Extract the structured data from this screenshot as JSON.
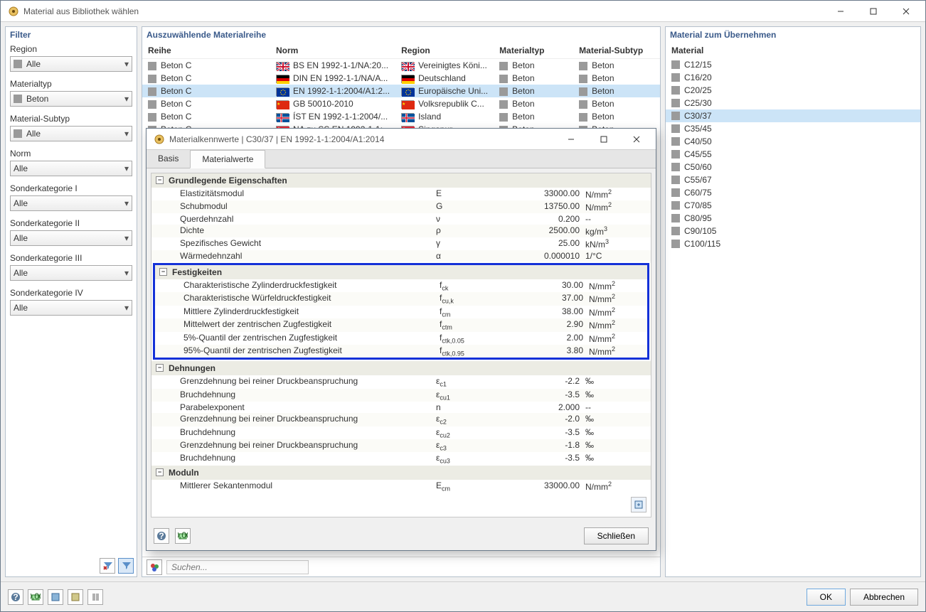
{
  "window": {
    "title": "Material aus Bibliothek wählen"
  },
  "filter": {
    "title": "Filter",
    "groups": [
      {
        "label": "Region",
        "value": "Alle",
        "swatch": true
      },
      {
        "label": "Materialtyp",
        "value": "Beton",
        "swatch": true
      },
      {
        "label": "Material-Subtyp",
        "value": "Alle",
        "swatch": true
      },
      {
        "label": "Norm",
        "value": "Alle",
        "swatch": false
      },
      {
        "label": "Sonderkategorie I",
        "value": "Alle",
        "swatch": false
      },
      {
        "label": "Sonderkategorie II",
        "value": "Alle",
        "swatch": false
      },
      {
        "label": "Sonderkategorie III",
        "value": "Alle",
        "swatch": false
      },
      {
        "label": "Sonderkategorie IV",
        "value": "Alle",
        "swatch": false
      }
    ]
  },
  "series": {
    "title": "Auszuwählende Materialreihe",
    "columns": [
      "Reihe",
      "Norm",
      "Region",
      "Materialtyp",
      "Material-Subtyp"
    ],
    "rows": [
      {
        "reihe": "Beton C",
        "norm": "BS EN 1992-1-1/NA:20...",
        "region": "Vereinigtes Köni...",
        "mtype": "Beton",
        "msub": "Beton",
        "flag": "uk",
        "sel": false
      },
      {
        "reihe": "Beton C",
        "norm": "DIN EN 1992-1-1/NA/A...",
        "region": "Deutschland",
        "mtype": "Beton",
        "msub": "Beton",
        "flag": "de",
        "sel": false
      },
      {
        "reihe": "Beton C",
        "norm": "EN 1992-1-1:2004/A1:2...",
        "region": "Europäische Uni...",
        "mtype": "Beton",
        "msub": "Beton",
        "flag": "eu",
        "sel": true
      },
      {
        "reihe": "Beton C",
        "norm": "GB 50010-2010",
        "region": "Volksrepublik C...",
        "mtype": "Beton",
        "msub": "Beton",
        "flag": "cn",
        "sel": false
      },
      {
        "reihe": "Beton C",
        "norm": "ÍST EN 1992-1-1:2004/...",
        "region": "Island",
        "mtype": "Beton",
        "msub": "Beton",
        "flag": "is",
        "sel": false
      },
      {
        "reihe": "Beton C",
        "norm": "NA zu SS EN 1992-1-1:",
        "region": "Singapur",
        "mtype": "Beton",
        "msub": "Beton",
        "flag": "sg",
        "sel": false
      }
    ],
    "search_placeholder": "Suchen..."
  },
  "materials": {
    "title": "Material zum Übernehmen",
    "header": "Material",
    "items": [
      "C12/15",
      "C16/20",
      "C20/25",
      "C25/30",
      "C30/37",
      "C35/45",
      "C40/50",
      "C45/55",
      "C50/60",
      "C55/67",
      "C60/75",
      "C70/85",
      "C80/95",
      "C90/105",
      "C100/115"
    ],
    "selected": "C30/37"
  },
  "buttons": {
    "ok": "OK",
    "cancel": "Abbrechen",
    "close": "Schließen"
  },
  "modal": {
    "title": "Materialkennwerte | C30/37 | EN 1992-1-1:2004/A1:2014",
    "tabs": [
      "Basis",
      "Materialwerte"
    ],
    "active_tab": 1,
    "groups": [
      {
        "name": "Grundlegende Eigenschaften",
        "highlight": false,
        "rows": [
          {
            "label": "Elastizitätsmodul",
            "sym": "E",
            "val": "33000.00",
            "unit": "N/mm²"
          },
          {
            "label": "Schubmodul",
            "sym": "G",
            "val": "13750.00",
            "unit": "N/mm²"
          },
          {
            "label": "Querdehnzahl",
            "sym": "ν",
            "val": "0.200",
            "unit": "--"
          },
          {
            "label": "Dichte",
            "sym": "ρ",
            "val": "2500.00",
            "unit": "kg/m³"
          },
          {
            "label": "Spezifisches Gewicht",
            "sym": "γ",
            "val": "25.00",
            "unit": "kN/m³"
          },
          {
            "label": "Wärmedehnzahl",
            "sym": "α",
            "val": "0.000010",
            "unit": "1/°C"
          }
        ]
      },
      {
        "name": "Festigkeiten",
        "highlight": true,
        "rows": [
          {
            "label": "Charakteristische Zylinderdruckfestigkeit",
            "sym": "f_ck",
            "val": "30.00",
            "unit": "N/mm²"
          },
          {
            "label": "Charakteristische Würfeldruckfestigkeit",
            "sym": "f_cu,k",
            "val": "37.00",
            "unit": "N/mm²"
          },
          {
            "label": "Mittlere Zylinderdruckfestigkeit",
            "sym": "f_cm",
            "val": "38.00",
            "unit": "N/mm²"
          },
          {
            "label": "Mittelwert der zentrischen Zugfestigkeit",
            "sym": "f_ctm",
            "val": "2.90",
            "unit": "N/mm²"
          },
          {
            "label": "5%-Quantil der zentrischen Zugfestigkeit",
            "sym": "f_ctk,0.05",
            "val": "2.00",
            "unit": "N/mm²"
          },
          {
            "label": "95%-Quantil der zentrischen Zugfestigkeit",
            "sym": "f_ctk,0.95",
            "val": "3.80",
            "unit": "N/mm²"
          }
        ]
      },
      {
        "name": "Dehnungen",
        "highlight": false,
        "rows": [
          {
            "label": "Grenzdehnung bei reiner Druckbeanspruchung",
            "sym": "ε_c1",
            "val": "-2.2",
            "unit": "‰"
          },
          {
            "label": "Bruchdehnung",
            "sym": "ε_cu1",
            "val": "-3.5",
            "unit": "‰"
          },
          {
            "label": "Parabelexponent",
            "sym": "n",
            "val": "2.000",
            "unit": "--"
          },
          {
            "label": "Grenzdehnung bei reiner Druckbeanspruchung",
            "sym": "ε_c2",
            "val": "-2.0",
            "unit": "‰"
          },
          {
            "label": "Bruchdehnung",
            "sym": "ε_cu2",
            "val": "-3.5",
            "unit": "‰"
          },
          {
            "label": "Grenzdehnung bei reiner Druckbeanspruchung",
            "sym": "ε_c3",
            "val": "-1.8",
            "unit": "‰"
          },
          {
            "label": "Bruchdehnung",
            "sym": "ε_cu3",
            "val": "-3.5",
            "unit": "‰"
          }
        ]
      },
      {
        "name": "Moduln",
        "highlight": false,
        "rows": [
          {
            "label": "Mittlerer Sekantenmodul",
            "sym": "E_cm",
            "val": "33000.00",
            "unit": "N/mm²"
          }
        ]
      }
    ]
  }
}
